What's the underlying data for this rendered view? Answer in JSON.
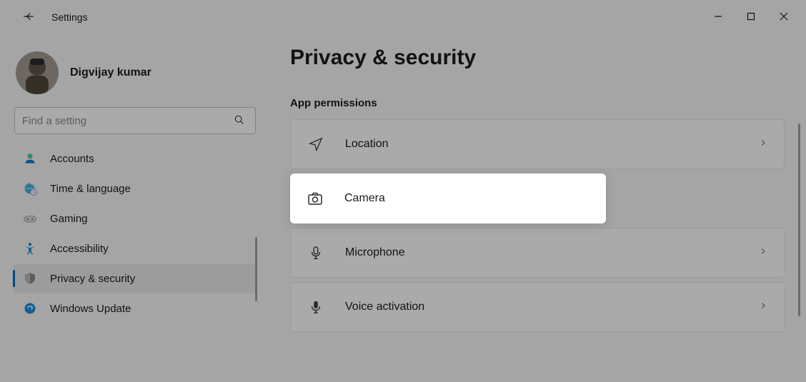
{
  "app": {
    "title": "Settings"
  },
  "user": {
    "name": "Digvijay kumar"
  },
  "search": {
    "placeholder": "Find a setting"
  },
  "sidebar": {
    "items": [
      {
        "label": "Accounts"
      },
      {
        "label": "Time & language"
      },
      {
        "label": "Gaming"
      },
      {
        "label": "Accessibility"
      },
      {
        "label": "Privacy & security",
        "selected": true
      },
      {
        "label": "Windows Update"
      }
    ]
  },
  "page": {
    "title": "Privacy & security",
    "section_title": "App permissions",
    "items": [
      {
        "label": "Location"
      },
      {
        "label": "Camera",
        "highlight": true
      },
      {
        "label": "Microphone"
      },
      {
        "label": "Voice activation"
      }
    ]
  }
}
